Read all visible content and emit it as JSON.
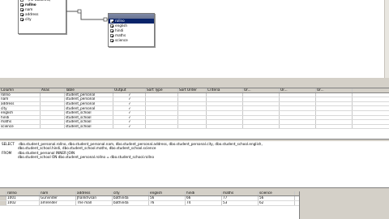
{
  "diagram": {
    "table_left": {
      "items": [
        {
          "label": "* (All Columns)",
          "checked": false
        },
        {
          "label": "rollno",
          "checked": true,
          "bold": true
        },
        {
          "label": "nam",
          "checked": true
        },
        {
          "label": "address",
          "checked": true
        },
        {
          "label": "city",
          "checked": true
        }
      ]
    },
    "table_right": {
      "items": [
        {
          "label": "rollno",
          "checked": true,
          "selected": true
        },
        {
          "label": "english",
          "checked": true
        },
        {
          "label": "hindi",
          "checked": true
        },
        {
          "label": "maths",
          "checked": true
        },
        {
          "label": "science",
          "checked": true
        }
      ]
    }
  },
  "grid": {
    "headers": [
      "Column",
      "Alias",
      "Table",
      "Output",
      "Sort Type",
      "Sort Order",
      "Criteria",
      "Or...",
      "Or...",
      "Or..."
    ],
    "rows": [
      {
        "column": "rollno",
        "table": "student_personal",
        "output": true
      },
      {
        "column": "nam",
        "table": "student_personal",
        "output": true
      },
      {
        "column": "address",
        "table": "student_personal",
        "output": true
      },
      {
        "column": "city",
        "table": "student_personal",
        "output": true
      },
      {
        "column": "english",
        "table": "student_school",
        "output": true
      },
      {
        "column": "hindi",
        "table": "student_school",
        "output": true
      },
      {
        "column": "maths",
        "table": "student_school",
        "output": true
      },
      {
        "column": "science",
        "table": "student_school",
        "output": true
      }
    ]
  },
  "sql": {
    "lines": [
      "SELECT    dbo.student_personal.rollno, dbo.student_personal.nam, dbo.student_personal.address, dbo.student_personal.city, dbo.student_school.english,",
      "               dbo.student_school.hindi, dbo.student_school.maths, dbo.student_school.science",
      "FROM      dbo.student_personal INNER JOIN",
      "               dbo.student_school ON dbo.student_personal.rollno = dbo.student_school.rollno"
    ]
  },
  "results": {
    "headers": [
      "rollno",
      "nam",
      "address",
      "city",
      "english",
      "hindi",
      "maths",
      "science"
    ],
    "rows": [
      [
        "1001",
        "Gurvinder",
        "Jhankhvsan",
        "bathinda",
        "56",
        "66",
        "77",
        "56"
      ],
      [
        "1002",
        "amrender",
        "The mall",
        "bathinda",
        "76",
        "74",
        "53",
        "62"
      ]
    ]
  }
}
